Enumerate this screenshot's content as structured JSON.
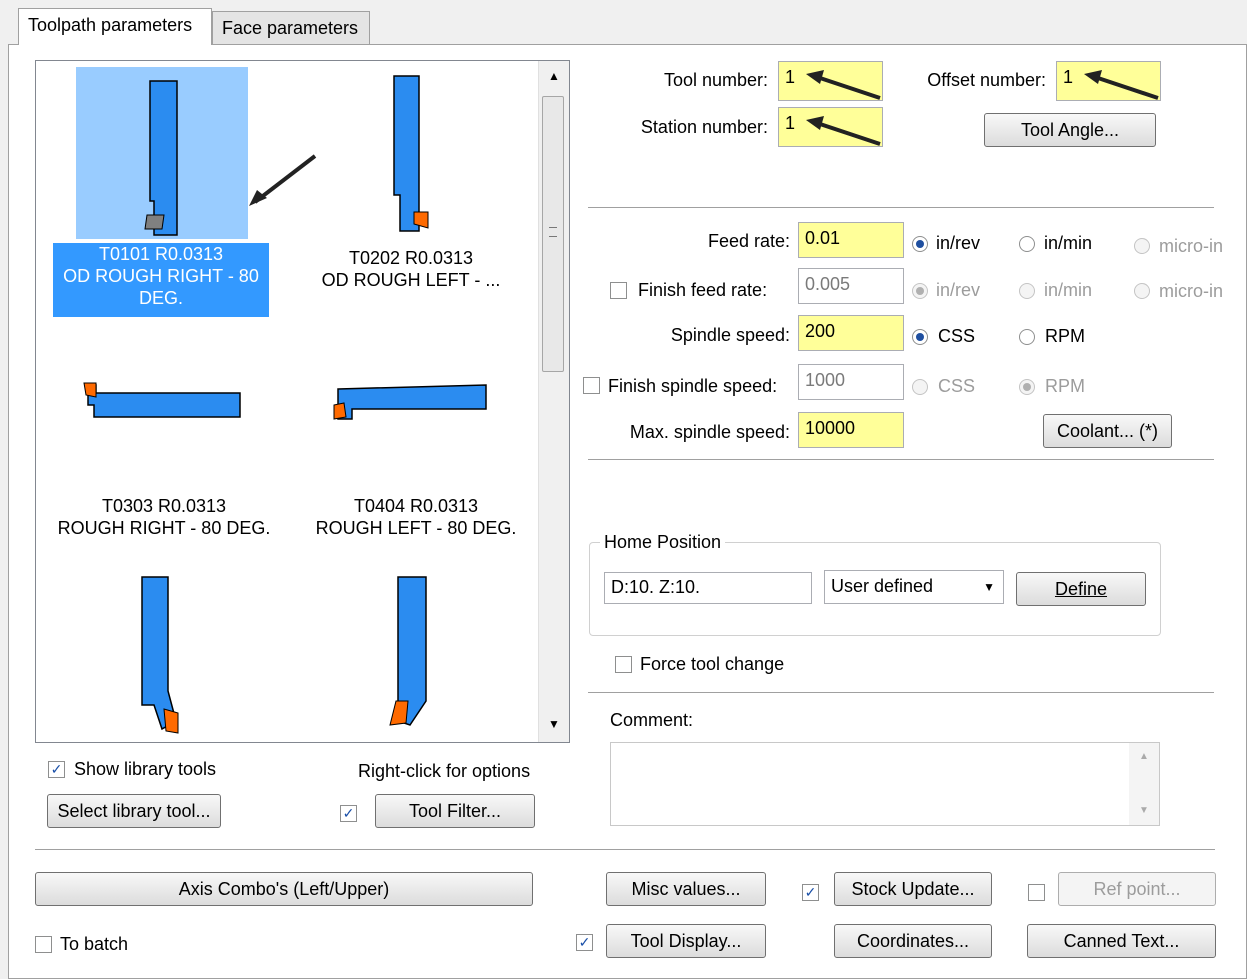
{
  "tabs": [
    "Toolpath parameters",
    "Face parameters"
  ],
  "tools": [
    {
      "id": "T0101 R0.0313",
      "desc": "OD ROUGH RIGHT - 80 DEG."
    },
    {
      "id": "T0202 R0.0313",
      "desc": "OD ROUGH LEFT - ..."
    },
    {
      "id": "T0303 R0.0313",
      "desc": "ROUGH RIGHT - 80 DEG."
    },
    {
      "id": "T0404 R0.0313",
      "desc": "ROUGH LEFT - 80 DEG."
    }
  ],
  "tool_number": {
    "label": "Tool number:",
    "value": "1"
  },
  "offset_number": {
    "label": "Offset number:",
    "value": "1"
  },
  "station_number": {
    "label": "Station number:",
    "value": "1"
  },
  "tool_angle_button": "Tool Angle...",
  "feed_rate": {
    "label": "Feed rate:",
    "value": "0.01"
  },
  "finish_feed_rate": {
    "label": "Finish feed rate:",
    "value": "0.005"
  },
  "spindle_speed": {
    "label": "Spindle speed:",
    "value": "200"
  },
  "finish_spindle_speed": {
    "label": "Finish spindle speed:",
    "value": "1000"
  },
  "max_spindle_speed": {
    "label": "Max. spindle speed:",
    "value": "10000"
  },
  "units": {
    "in_rev": "in/rev",
    "in_min": "in/min",
    "micro_in": "micro-in",
    "css": "CSS",
    "rpm": "RPM"
  },
  "coolant_button": "Coolant... (*)",
  "home_position": {
    "legend": "Home Position",
    "value": "D:10.  Z:10.",
    "mode": "User defined",
    "define_button": "Define"
  },
  "force_tool_change": "Force tool change",
  "comment_label": "Comment:",
  "show_library_tools": "Show library tools",
  "right_click_hint": "Right-click for options",
  "select_library_tool": "Select library tool...",
  "tool_filter": "Tool Filter...",
  "axis_combo": "Axis Combo's (Left/Upper)",
  "misc_values": "Misc values...",
  "stock_update": "Stock Update...",
  "ref_point": "Ref point...",
  "to_batch": "To batch",
  "tool_display": "Tool Display...",
  "coordinates": "Coordinates...",
  "canned_text": "Canned Text...",
  "colors": {
    "selection": "#3399ff",
    "tool_body": "#2b8cf0",
    "tool_insert": "#ff6a00",
    "highlight_field": "#ffff99"
  }
}
